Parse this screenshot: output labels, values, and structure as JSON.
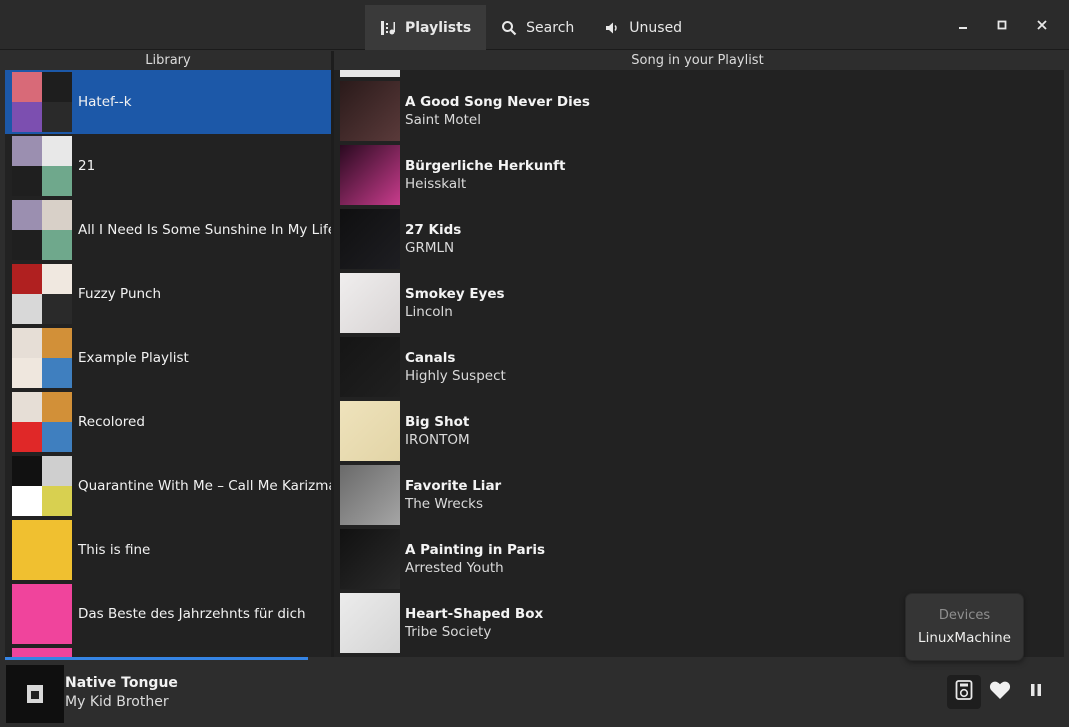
{
  "header": {
    "tabs": [
      {
        "label": "Playlists",
        "icon": "playlists-icon",
        "active": true
      },
      {
        "label": "Search",
        "icon": "search-icon",
        "active": false
      },
      {
        "label": "Unused",
        "icon": "speaker-icon",
        "active": false
      }
    ],
    "window_controls": [
      "minimize-icon",
      "maximize-icon",
      "close-icon"
    ]
  },
  "library": {
    "header": "Library",
    "playlists": [
      {
        "name": "Hatef--k",
        "selected": true,
        "art": [
          "#d86a78",
          "#1e1e1e",
          "#7c4fb0",
          "#2a2a2a"
        ]
      },
      {
        "name": "21",
        "selected": false,
        "art": [
          "#9b8fb0",
          "#e8e8e8",
          "#1f1f1f",
          "#6fa88c"
        ]
      },
      {
        "name": "All I Need Is Some Sunshine In My Life",
        "selected": false,
        "art": [
          "#9b8fb0",
          "#d8d0c8",
          "#1f1f1f",
          "#6fa88c"
        ]
      },
      {
        "name": "Fuzzy Punch",
        "selected": false,
        "art": [
          "#b02020",
          "#f0e8e0",
          "#d8d8d8",
          "#2a2a2a"
        ]
      },
      {
        "name": "Example Playlist",
        "selected": false,
        "art": [
          "#e6ded6",
          "#d29038",
          "#efe7de",
          "#3f7fbf"
        ]
      },
      {
        "name": "Recolored",
        "selected": false,
        "art": [
          "#e6ded6",
          "#d29038",
          "#e02828",
          "#3f7fbf"
        ]
      },
      {
        "name": "Quarantine With Me – Call Me Karizma",
        "selected": false,
        "art": [
          "#111111",
          "#cfcfcf",
          "#ffffff",
          "#d8d050"
        ]
      },
      {
        "name": "This is fine",
        "selected": false,
        "art": [
          "#f0c030",
          "#f0c030",
          "#f0c030",
          "#f0c030"
        ]
      },
      {
        "name": "Das Beste des Jahrzehnts für dich",
        "selected": false,
        "art": [
          "#f0449c",
          "#f0449c",
          "#f0449c",
          "#f0449c"
        ]
      },
      {
        "name": "",
        "selected": false,
        "art": [
          "#f0449c",
          "#f0449c",
          "#f0449c",
          "#f0449c"
        ]
      }
    ]
  },
  "songs": {
    "header": "Song in your Playlist",
    "items": [
      {
        "title": "",
        "artist": "",
        "cover": [
          "#e8e8e8",
          "#e8e8e8"
        ]
      },
      {
        "title": "A Good Song Never Dies",
        "artist": "Saint Motel",
        "cover": [
          "#2a1a1a",
          "#5a3a3a"
        ]
      },
      {
        "title": "Bürgerliche Herkunft",
        "artist": "Heisskalt",
        "cover": [
          "#2a0a20",
          "#c83c8c"
        ]
      },
      {
        "title": "27 Kids",
        "artist": "GRMLN",
        "cover": [
          "#0f0f10",
          "#1e1e22"
        ]
      },
      {
        "title": "Smokey Eyes",
        "artist": "Lincoln",
        "cover": [
          "#f0eeee",
          "#d8d4d4"
        ]
      },
      {
        "title": "Canals",
        "artist": "Highly Suspect",
        "cover": [
          "#151515",
          "#202020"
        ]
      },
      {
        "title": "Big Shot",
        "artist": "IRONTOM",
        "cover": [
          "#efe3bc",
          "#e2d4a6"
        ]
      },
      {
        "title": "Favorite Liar",
        "artist": "The Wrecks",
        "cover": [
          "#6a6a6a",
          "#a5a5a5"
        ]
      },
      {
        "title": "A Painting in Paris",
        "artist": "Arrested Youth",
        "cover": [
          "#111111",
          "#2a2a2a"
        ]
      },
      {
        "title": "Heart-Shaped Box",
        "artist": "Tribe Society",
        "cover": [
          "#ececec",
          "#d4d4d4"
        ]
      }
    ]
  },
  "player": {
    "title": "Native Tongue",
    "artist": "My Kid Brother",
    "progress_fraction": 0.286,
    "buttons": [
      "devices-icon",
      "heart-icon",
      "pause-icon"
    ]
  },
  "devices_popover": {
    "title": "Devices",
    "device": "LinuxMachine"
  },
  "colors": {
    "accent": "#1c58a8",
    "progress": "#3584e4"
  }
}
